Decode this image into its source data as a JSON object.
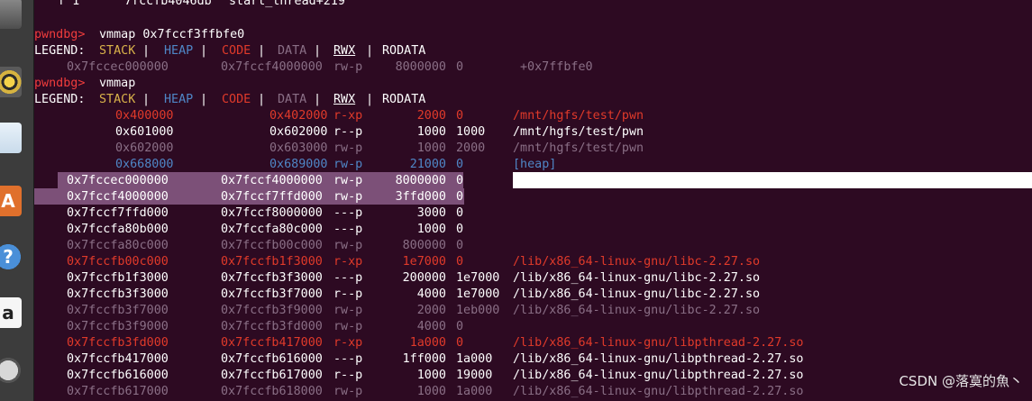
{
  "colors": {
    "background": "#2d0a22",
    "prompt": "#f03c3c",
    "stack": "#d9b24a",
    "heap": "#4f86c6",
    "code": "#e03a2a",
    "data": "#8a6f86",
    "normal": "#ffffff",
    "rodata": "#ffffff",
    "selection": "#7c5078"
  },
  "dock": [
    {
      "name": "file-cabinet-icon"
    },
    {
      "name": "speaker-icon"
    },
    {
      "name": "document-icon"
    },
    {
      "name": "software-center-icon",
      "glyph": "A"
    },
    {
      "name": "help-icon",
      "glyph": "?"
    },
    {
      "name": "amazon-icon",
      "glyph": "a"
    },
    {
      "name": "settings-icon"
    }
  ],
  "top_partial": {
    "frame": "f 1",
    "addr": "7fccfb4046db",
    "symbol": "start_thread+219"
  },
  "cmd1": {
    "prompt": "pwndbg>",
    "command": "vmmap 0x7fccf3ffbfe0"
  },
  "legend": {
    "prefix": "LEGEND:",
    "stack": "STACK",
    "heap": "HEAP",
    "code": "CODE",
    "data": "DATA",
    "rwx": "RWX",
    "rodata": "RODATA",
    "sep": "|"
  },
  "single_row": {
    "start": "0x7fccec000000",
    "end": "0x7fccf4000000",
    "perms": "rw-p",
    "size": "8000000",
    "offset": "0",
    "name": "+0x7ffbfe0"
  },
  "cmd2": {
    "prompt": "pwndbg>",
    "command": "vmmap"
  },
  "rows": [
    {
      "start": "0x400000",
      "end": "0x402000",
      "perms": "r-xp",
      "size": "2000",
      "offset": "0",
      "name": "/mnt/hgfs/test/pwn",
      "kind": "code"
    },
    {
      "start": "0x601000",
      "end": "0x602000",
      "perms": "r--p",
      "size": "1000",
      "offset": "1000",
      "name": "/mnt/hgfs/test/pwn",
      "kind": "normal"
    },
    {
      "start": "0x602000",
      "end": "0x603000",
      "perms": "rw-p",
      "size": "1000",
      "offset": "2000",
      "name": "/mnt/hgfs/test/pwn",
      "kind": "data"
    },
    {
      "start": "0x668000",
      "end": "0x689000",
      "perms": "rw-p",
      "size": "21000",
      "offset": "0",
      "name": "[heap]",
      "kind": "heap"
    },
    {
      "start": "0x7fccec000000",
      "end": "0x7fccf4000000",
      "perms": "rw-p",
      "size": "8000000",
      "offset": "0",
      "name": "",
      "kind": "selected"
    },
    {
      "start": "0x7fccf4000000",
      "end": "0x7fccf7ffd000",
      "perms": "rw-p",
      "size": "3ffd000",
      "offset": "0",
      "name": "",
      "kind": "selected"
    },
    {
      "start": "0x7fccf7ffd000",
      "end": "0x7fccf8000000",
      "perms": "---p",
      "size": "3000",
      "offset": "0",
      "name": "",
      "kind": "normal"
    },
    {
      "start": "0x7fccfa80b000",
      "end": "0x7fccfa80c000",
      "perms": "---p",
      "size": "1000",
      "offset": "0",
      "name": "",
      "kind": "normal"
    },
    {
      "start": "0x7fccfa80c000",
      "end": "0x7fccfb00c000",
      "perms": "rw-p",
      "size": "800000",
      "offset": "0",
      "name": "",
      "kind": "data"
    },
    {
      "start": "0x7fccfb00c000",
      "end": "0x7fccfb1f3000",
      "perms": "r-xp",
      "size": "1e7000",
      "offset": "0",
      "name": "/lib/x86_64-linux-gnu/libc-2.27.so",
      "kind": "code"
    },
    {
      "start": "0x7fccfb1f3000",
      "end": "0x7fccfb3f3000",
      "perms": "---p",
      "size": "200000",
      "offset": "1e7000",
      "name": "/lib/x86_64-linux-gnu/libc-2.27.so",
      "kind": "normal"
    },
    {
      "start": "0x7fccfb3f3000",
      "end": "0x7fccfb3f7000",
      "perms": "r--p",
      "size": "4000",
      "offset": "1e7000",
      "name": "/lib/x86_64-linux-gnu/libc-2.27.so",
      "kind": "normal"
    },
    {
      "start": "0x7fccfb3f7000",
      "end": "0x7fccfb3f9000",
      "perms": "rw-p",
      "size": "2000",
      "offset": "1eb000",
      "name": "/lib/x86_64-linux-gnu/libc-2.27.so",
      "kind": "data"
    },
    {
      "start": "0x7fccfb3f9000",
      "end": "0x7fccfb3fd000",
      "perms": "rw-p",
      "size": "4000",
      "offset": "0",
      "name": "",
      "kind": "data"
    },
    {
      "start": "0x7fccfb3fd000",
      "end": "0x7fccfb417000",
      "perms": "r-xp",
      "size": "1a000",
      "offset": "0",
      "name": "/lib/x86_64-linux-gnu/libpthread-2.27.so",
      "kind": "code"
    },
    {
      "start": "0x7fccfb417000",
      "end": "0x7fccfb616000",
      "perms": "---p",
      "size": "1ff000",
      "offset": "1a000",
      "name": "/lib/x86_64-linux-gnu/libpthread-2.27.so",
      "kind": "normal"
    },
    {
      "start": "0x7fccfb616000",
      "end": "0x7fccfb617000",
      "perms": "r--p",
      "size": "1000",
      "offset": "19000",
      "name": "/lib/x86_64-linux-gnu/libpthread-2.27.so",
      "kind": "normal"
    },
    {
      "start": "0x7fccfb617000",
      "end": "0x7fccfb618000",
      "perms": "rw-p",
      "size": "1000",
      "offset": "1a000",
      "name": "/lib/x86_64-linux-gnu/libpthread-2.27.so",
      "kind": "data"
    }
  ],
  "watermark": "CSDN @落寞的魚丶"
}
